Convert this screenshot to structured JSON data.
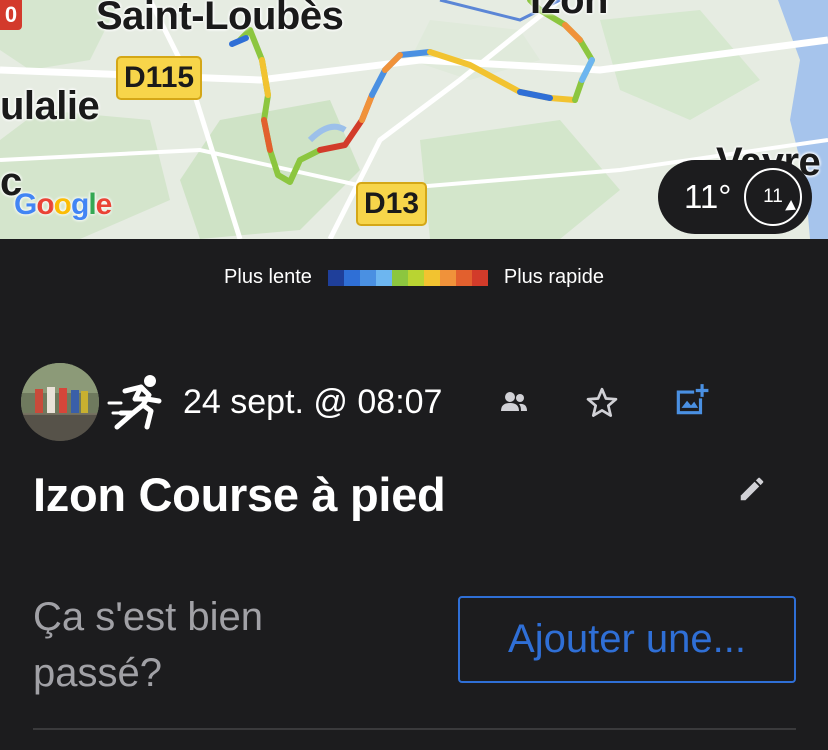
{
  "map": {
    "place_labels": {
      "saint_loubes": "Saint-Loubès",
      "izon": "Izon",
      "ulalie": "ulalie",
      "vayres": "Vayre",
      "c_partial": "c"
    },
    "road_badges": {
      "d115": "D115",
      "d13": "D13"
    },
    "corner_badge": "0",
    "google": "Google",
    "weather": {
      "temperature": "11°",
      "wind_speed": "11"
    }
  },
  "legend": {
    "slow_label": "Plus lente",
    "fast_label": "Plus rapide",
    "colors": [
      "#1f3f9a",
      "#2f6fd6",
      "#4a90e2",
      "#6db6f0",
      "#8cc63f",
      "#b9d432",
      "#f2c330",
      "#f0923a",
      "#e2602e",
      "#d23b2a"
    ]
  },
  "activity": {
    "type_icon": "running-icon",
    "datetime": "24 sept. @ 08:07",
    "title": "Izon Course à pied",
    "prompt": "Ça s'est bien passé?",
    "add_button": "Ajouter une..."
  },
  "colors": {
    "background": "#1c1c1e",
    "accent": "#2f6fd6",
    "muted_text": "#a1a1a6"
  }
}
